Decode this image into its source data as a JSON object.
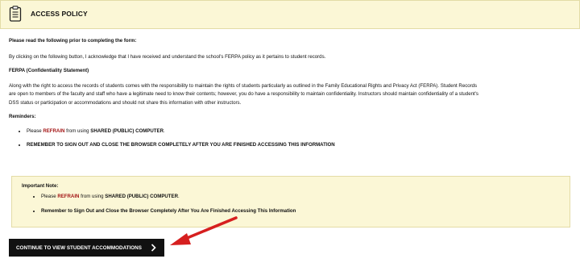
{
  "header": {
    "title": "ACCESS POLICY",
    "icon": "clipboard-icon"
  },
  "intro": {
    "heading": "Please read the following prior to completing the form:",
    "acknowledgement": "By clicking on the following button, I acknowledge that I have received and understand the school's FERPA policy as it pertains to student records."
  },
  "ferpa": {
    "heading": "FERPA (Confidentiality Statement)",
    "line1": "Along with the right to access the records of students comes with the responsibility to maintain the rights of students particularly as outlined in the Family Educational Rights and Privacy Act (FERPA). Student Records",
    "line2": "are open to members of the faculty and staff who have a legitimate need to know their contents; however, you do have a responsibility to maintain confidentiality. Instructors should maintain confidentiality of a student's",
    "line3": "DSS status or participation or accommodations and should not share this information with other instructors."
  },
  "reminders": {
    "heading": "Reminders:",
    "item1_prefix": "Please ",
    "item1_red": "REFRAIN",
    "item1_middle": " from using ",
    "item1_bold": "SHARED (PUBLIC) COMPUTER",
    "item1_suffix": ".",
    "item2": "REMEMBER TO SIGN OUT AND CLOSE THE BROWSER COMPLETELY AFTER YOU ARE FINISHED ACCESSING THIS INFORMATION"
  },
  "note": {
    "heading": "Important Note:",
    "item1_prefix": "Please ",
    "item1_red": "REFRAIN",
    "item1_middle": " from using ",
    "item1_bold": "SHARED (PUBLIC) COMPUTER",
    "item1_suffix": ".",
    "item2": "Remember to Sign Out and Close the Browser Completely After You Are Finished Accessing This Information"
  },
  "continue_button": {
    "label": "CONTINUE TO VIEW STUDENT ACCOMMODATIONS",
    "icon": "chevron-right-icon"
  },
  "colors": {
    "header_bg": "#fbf7d6",
    "accent_red": "#a31515",
    "button_bg": "#111111",
    "arrow": "#d61f1f"
  }
}
